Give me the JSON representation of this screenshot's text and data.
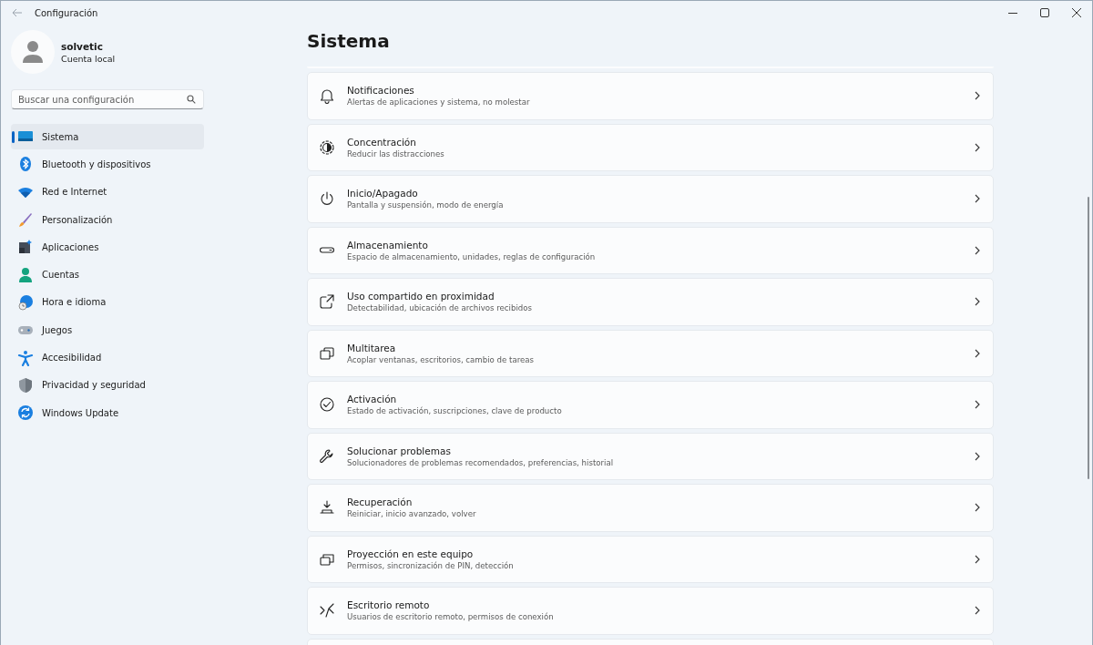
{
  "window": {
    "title": "Configuración"
  },
  "profile": {
    "name": "solvetic",
    "account": "Cuenta local"
  },
  "search": {
    "placeholder": "Buscar una configuración"
  },
  "sidebar": {
    "items": [
      {
        "label": "Sistema",
        "selected": true
      },
      {
        "label": "Bluetooth y dispositivos",
        "selected": false
      },
      {
        "label": "Red e Internet",
        "selected": false
      },
      {
        "label": "Personalización",
        "selected": false
      },
      {
        "label": "Aplicaciones",
        "selected": false
      },
      {
        "label": "Cuentas",
        "selected": false
      },
      {
        "label": "Hora e idioma",
        "selected": false
      },
      {
        "label": "Juegos",
        "selected": false
      },
      {
        "label": "Accesibilidad",
        "selected": false
      },
      {
        "label": "Privacidad y seguridad",
        "selected": false
      },
      {
        "label": "Windows Update",
        "selected": false
      }
    ]
  },
  "page": {
    "title": "Sistema"
  },
  "settings": [
    {
      "title": "Notificaciones",
      "subtitle": "Alertas de aplicaciones y sistema, no molestar"
    },
    {
      "title": "Concentración",
      "subtitle": "Reducir las distracciones"
    },
    {
      "title": "Inicio/Apagado",
      "subtitle": "Pantalla y suspensión, modo de energía"
    },
    {
      "title": "Almacenamiento",
      "subtitle": "Espacio de almacenamiento, unidades, reglas de configuración"
    },
    {
      "title": "Uso compartido en proximidad",
      "subtitle": "Detectabilidad, ubicación de archivos recibidos"
    },
    {
      "title": "Multitarea",
      "subtitle": "Acoplar ventanas, escritorios, cambio de tareas"
    },
    {
      "title": "Activación",
      "subtitle": "Estado de activación, suscripciones, clave de producto"
    },
    {
      "title": "Solucionar problemas",
      "subtitle": "Solucionadores de problemas recomendados, preferencias, historial"
    },
    {
      "title": "Recuperación",
      "subtitle": "Reiniciar, inicio avanzado, volver"
    },
    {
      "title": "Proyección en este equipo",
      "subtitle": "Permisos, sincronización de PIN, detección"
    },
    {
      "title": "Escritorio remoto",
      "subtitle": "Usuarios de escritorio remoto, permisos de conexión"
    }
  ]
}
